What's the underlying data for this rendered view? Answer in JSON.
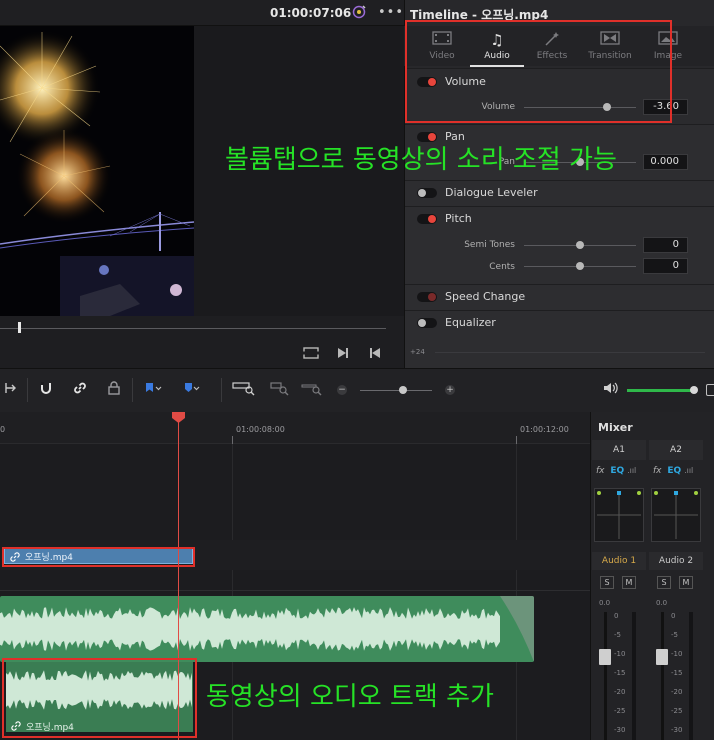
{
  "viewer": {
    "timecode": "01:00:07:06",
    "more_icon": "more-icon",
    "viewer_icon": "color-picker-icon"
  },
  "inspector": {
    "title": "Timeline - 오프닝.mp4",
    "tabs": [
      {
        "label": "Video",
        "icon": "film-icon"
      },
      {
        "label": "Audio",
        "icon": "music-note-icon"
      },
      {
        "label": "Effects",
        "icon": "magic-wand-icon"
      },
      {
        "label": "Transition",
        "icon": "transition-icon"
      },
      {
        "label": "Image",
        "icon": "image-icon"
      }
    ],
    "active_tab": "Audio",
    "sections": {
      "volume": {
        "label": "Volume",
        "param_label": "Volume",
        "value": "-3.60",
        "level": 0.74
      },
      "pan": {
        "label": "Pan",
        "param_label": "Pan",
        "value": "0.000"
      },
      "dialogue": {
        "label": "Dialogue Leveler"
      },
      "pitch": {
        "label": "Pitch",
        "semi_label": "Semi Tones",
        "semi_value": "0",
        "cents_label": "Cents",
        "cents_value": "0"
      },
      "speed": {
        "label": "Speed Change"
      },
      "eq": {
        "label": "Equalizer",
        "scale_label": "+24"
      }
    }
  },
  "timeline": {
    "ruler_labels": [
      "0",
      "01:00:08:00",
      "01:00:12:00"
    ],
    "video_clip_name": "오프닝.mp4",
    "audio_clip_name": "오프닝.mp4"
  },
  "mixer": {
    "title": "Mixer",
    "channels": [
      {
        "id": "A1",
        "name": "Audio 1",
        "level": "0.0",
        "name_color": "#d6a94a"
      },
      {
        "id": "A2",
        "name": "Audio 2",
        "level": "0.0",
        "name_color": "#d0d0d0"
      }
    ],
    "fx_label": "fx",
    "eq_label": "EQ",
    "solo_label": "S",
    "mute_label": "M",
    "scale": [
      "0",
      "-5",
      "-10",
      "-15",
      "-20",
      "-25",
      "-30"
    ]
  },
  "annotations": {
    "inspector_note": "볼륨탭으로 동영상의 소리 조절 가능",
    "timeline_note": "동영상의 오디오 트랙 추가"
  },
  "colors": {
    "annotation": "#26e226",
    "highlight_box": "#e0302a",
    "playhead": "#e04b45",
    "video_clip": "#4d7fae",
    "audio_clip": "#3f8c5c"
  }
}
